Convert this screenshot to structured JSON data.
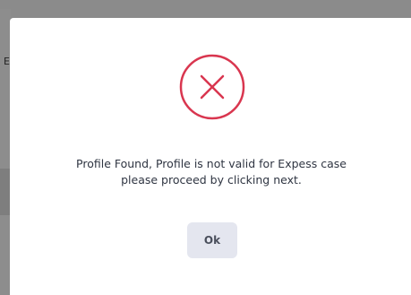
{
  "background": {
    "partial_text": "E"
  },
  "dialog": {
    "icon": "error-x-circle-icon",
    "icon_color": "#d9364f",
    "message_line1": "Profile Found, Profile is not valid for Expess case",
    "message_line2": "please proceed by clicking next.",
    "ok_label": "Ok",
    "ok_bg": "#e4e6ef"
  }
}
